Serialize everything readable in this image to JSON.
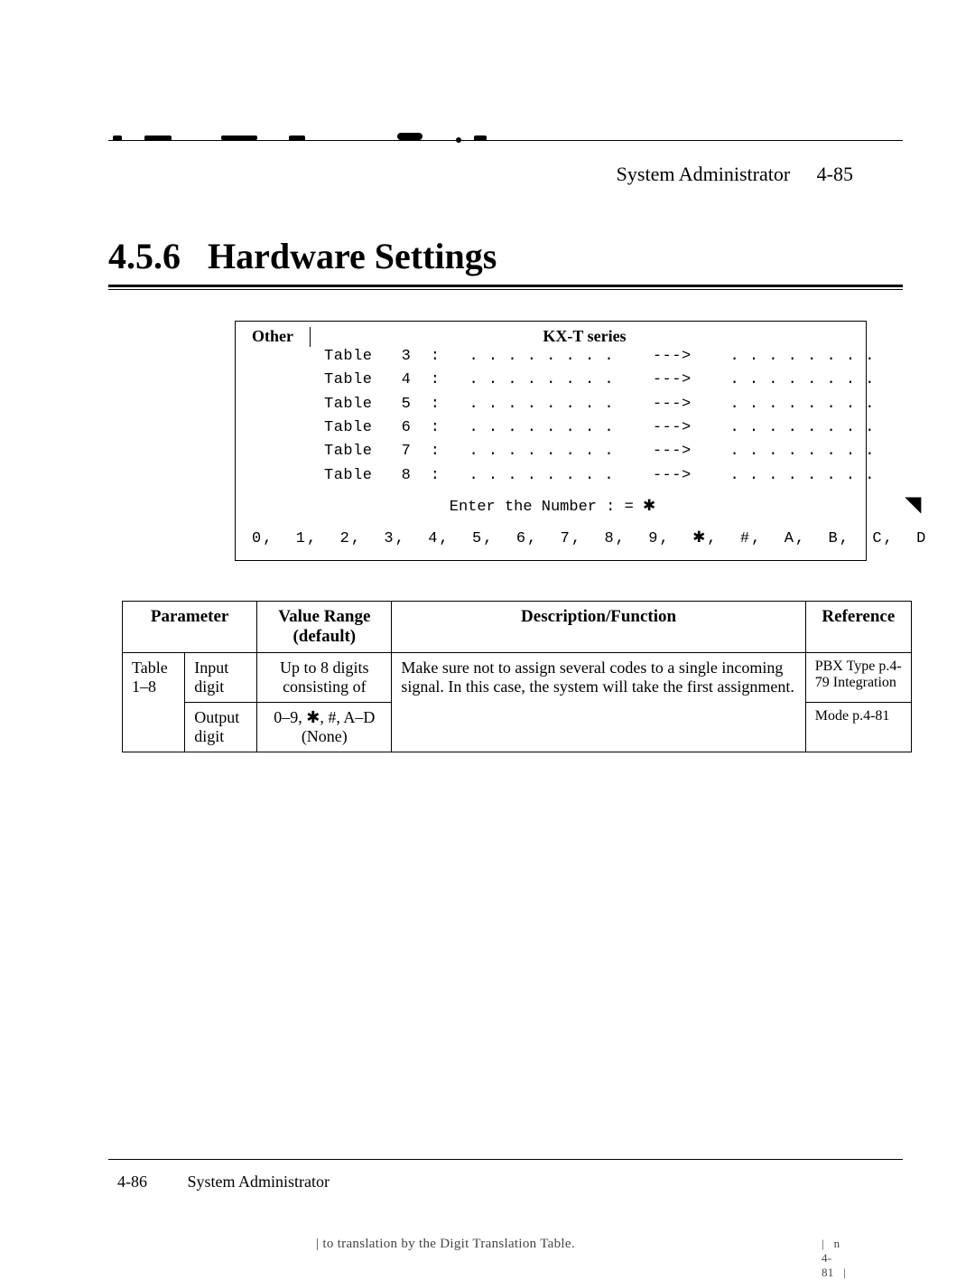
{
  "header": {
    "title": "System Administrator",
    "page": "4-85"
  },
  "section": {
    "number": "4.5.6",
    "title": "Hardware Settings"
  },
  "terminal": {
    "other_label": "Other",
    "series_label": "KX-T series",
    "rows": [
      {
        "label": "Table",
        "num": "3",
        "left": ". . . . . . . .",
        "arrow": "--->",
        "right": ". . . . . . . ."
      },
      {
        "label": "Table",
        "num": "4",
        "left": ". . . . . . . .",
        "arrow": "--->",
        "right": ". . . . . . . ."
      },
      {
        "label": "Table",
        "num": "5",
        "left": ". . . . . . . .",
        "arrow": "--->",
        "right": ". . . . . . . ."
      },
      {
        "label": "Table",
        "num": "6",
        "left": ". . . . . . . .",
        "arrow": "--->",
        "right": ". . . . . . . ."
      },
      {
        "label": "Table",
        "num": "7",
        "left": ". . . . . . . .",
        "arrow": "--->",
        "right": ". . . . . . . ."
      },
      {
        "label": "Table",
        "num": "8",
        "left": ". . . . . . . .",
        "arrow": "--->",
        "right": ". . . . . . . ."
      }
    ],
    "enter_prompt": "Enter the Number : = ✱",
    "digits": "0,  1,  2,  3,  4,  5,  6,  7,  8,  9,  ✱,  #,  A,  B,  C,  D"
  },
  "table": {
    "headers": {
      "parameter": "Parameter",
      "value_range": "Value Range (default)",
      "desc": "Description/Function",
      "ref": "Reference"
    },
    "row1": {
      "param_a": "Table 1–8",
      "param_b": "Input digit",
      "vr_top": "Up to 8 digits consisting of",
      "desc": "Make sure not to assign several codes to a single incoming signal.  In this case, the system will take the first assignment.",
      "ref_top": "PBX Type p.4-79 Integration"
    },
    "row2": {
      "param_b": "Output digit",
      "vr_bot": "0–9, ✱, #, A–D (None)",
      "ref_bot": "Mode p.4-81"
    }
  },
  "footer": {
    "page": "4-86",
    "title": "System Administrator"
  },
  "bottom_frag": {
    "text": "to translation by the Digit Translation Table.",
    "pgref": "n 4-81"
  }
}
